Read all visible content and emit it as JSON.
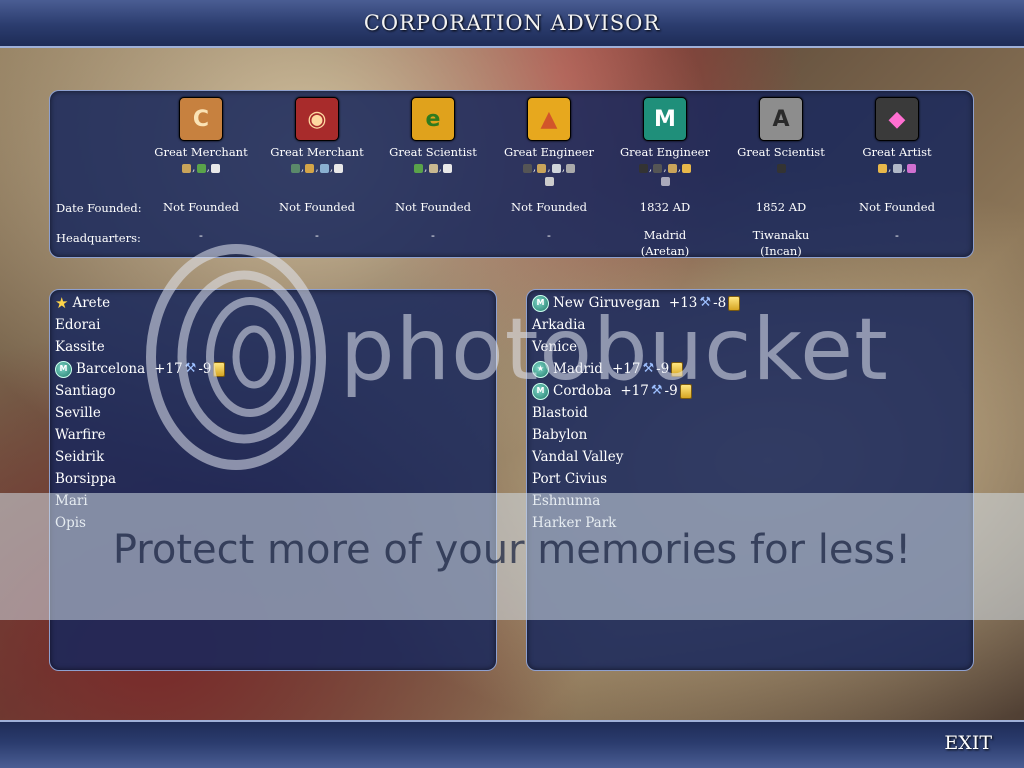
{
  "header": {
    "title": "CORPORATION ADVISOR"
  },
  "footer": {
    "exit_label": "EXIT"
  },
  "labels": {
    "date_founded": "Date Founded:",
    "headquarters": "Headquarters:"
  },
  "corporations": [
    {
      "icon": "C",
      "icon_name": "merchant-c-icon",
      "bg": "#c7813f",
      "fg": "#fbe3b5",
      "great_person": "Great Merchant",
      "resources": [
        [
          "#c9a45a",
          "#5aa34a",
          "#e8e8e8"
        ]
      ],
      "date": "Not Founded",
      "hq": "-",
      "hq2": ""
    },
    {
      "icon": "◉",
      "icon_name": "food-corp-icon",
      "bg": "#a82b2b",
      "fg": "#ffd9a0",
      "great_person": "Great Merchant",
      "resources": [
        [
          "#5a8a6a",
          "#d4a548",
          "#8ab0d0",
          "#e8e8e8"
        ]
      ],
      "date": "Not Founded",
      "hq": "-",
      "hq2": ""
    },
    {
      "icon": "e",
      "icon_name": "science-e-icon",
      "bg": "#e0a21c",
      "fg": "#2f7a1e",
      "great_person": "Great Scientist",
      "resources": [
        [
          "#5aa34a",
          "#c8b890",
          "#e8e8e8"
        ]
      ],
      "date": "Not Founded",
      "hq": "-",
      "hq2": ""
    },
    {
      "icon": "▲",
      "icon_name": "engineer-cone-icon",
      "bg": "#e7a81e",
      "fg": "#d2552a",
      "great_person": "Great Engineer",
      "resources": [
        [
          "#555",
          "#c9a45a",
          "#cfd4da",
          "#aaa"
        ],
        [
          "#ccc"
        ]
      ],
      "date": "Not Founded",
      "hq": "-",
      "hq2": ""
    },
    {
      "icon": "M",
      "icon_name": "mountain-m-icon",
      "bg": "#1f8f7a",
      "fg": "#ffffff",
      "great_person": "Great Engineer",
      "resources": [
        [
          "#333",
          "#555",
          "#c9a45a",
          "#e8b84a"
        ],
        [
          "#aab"
        ]
      ],
      "date": "1832 AD",
      "hq": "Madrid",
      "hq2": "(Aretan)"
    },
    {
      "icon": "A",
      "icon_name": "aluminum-a-icon",
      "bg": "#8d8d8d",
      "fg": "#2a2a2a",
      "great_person": "Great Scientist",
      "resources": [
        [
          "#333"
        ]
      ],
      "date": "1852 AD",
      "hq": "Tiwanaku",
      "hq2": "(Incan)"
    },
    {
      "icon": "◆",
      "icon_name": "diamond-icon",
      "bg": "#3a3a3a",
      "fg": "#ff6fd1",
      "great_person": "Great Artist",
      "resources": [
        [
          "#e8b84a",
          "#b0b8c8",
          "#d070d0"
        ]
      ],
      "date": "Not Founded",
      "hq": "-",
      "hq2": ""
    }
  ],
  "left_cities": [
    {
      "name": "Arete",
      "capital": true,
      "hq": false,
      "science": "",
      "gold": ""
    },
    {
      "name": "Edorai"
    },
    {
      "name": "Kassite"
    },
    {
      "name": "Barcelona",
      "hq": true,
      "science": "+17",
      "gold": "-9"
    },
    {
      "name": "Santiago"
    },
    {
      "name": "Seville"
    },
    {
      "name": "Warfire"
    },
    {
      "name": "Seidrik"
    },
    {
      "name": "Borsippa"
    },
    {
      "name": "Mari"
    },
    {
      "name": "Opis"
    }
  ],
  "right_cities": [
    {
      "name": "New Giruvegan",
      "hq": true,
      "science": "+13",
      "gold": "-8"
    },
    {
      "name": "Arkadia"
    },
    {
      "name": "Venice"
    },
    {
      "name": "Madrid",
      "hq": true,
      "capital": true,
      "science": "+17",
      "gold": "-9"
    },
    {
      "name": "Cordoba",
      "hq": true,
      "science": "+17",
      "gold": "-9"
    },
    {
      "name": "Blastoid"
    },
    {
      "name": "Babylon"
    },
    {
      "name": "Vandal Valley"
    },
    {
      "name": "Port Civius"
    },
    {
      "name": "Eshnunna"
    },
    {
      "name": "Harker Park"
    }
  ],
  "watermark": {
    "logo_text": "photobucket",
    "band_text": "Protect more of your memories for less!"
  }
}
